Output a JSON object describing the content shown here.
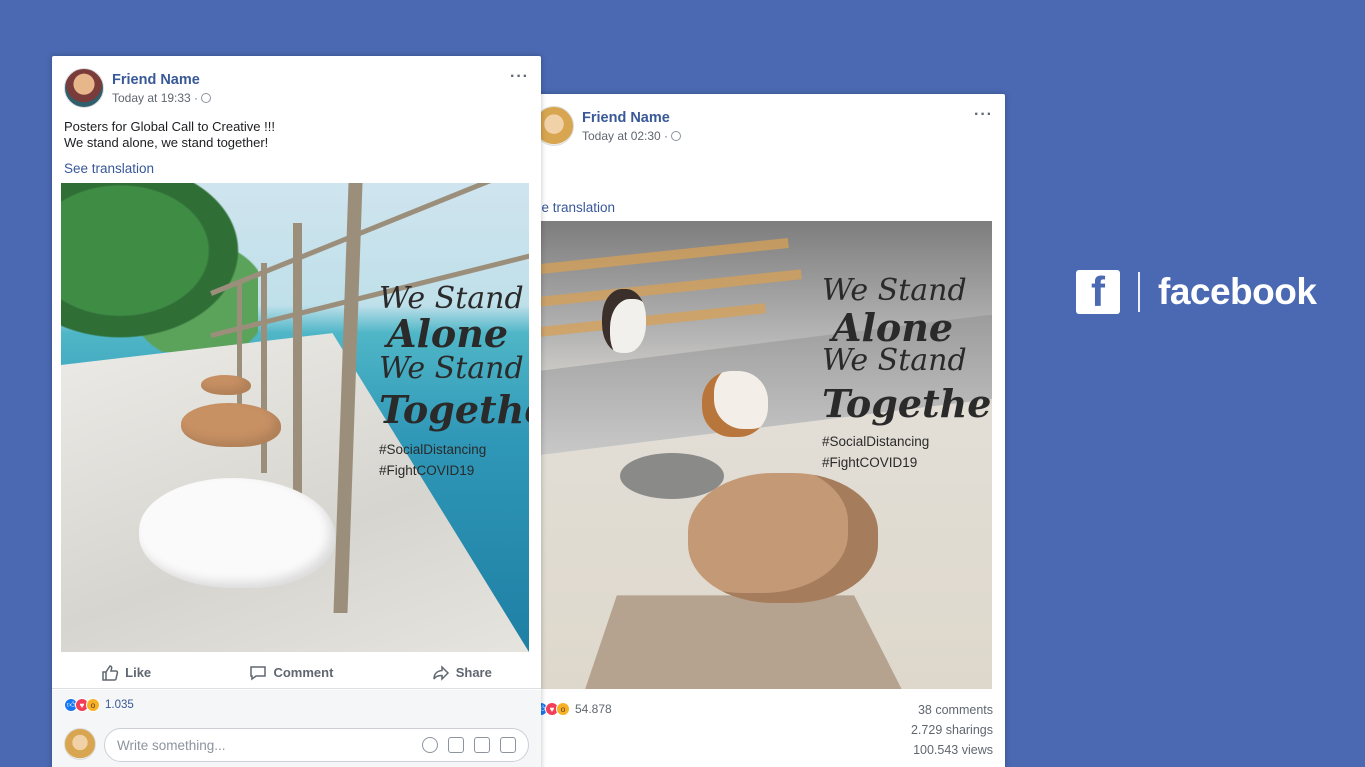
{
  "brand": {
    "logo_letter": "f",
    "wordmark": "facebook",
    "background_color": "#4a69b2"
  },
  "posts": [
    {
      "id": "front",
      "author": "Friend Name",
      "time": "Today at 19:33 ·",
      "text_lines": [
        "Posters for Global Call to Creative !!!",
        "We stand alone, we stand together!"
      ],
      "see_translation": "See translation",
      "poster": {
        "line1": "We Stand",
        "line2": "Alone",
        "line3": "We Stand",
        "line4": "Together",
        "hashtag1": "#SocialDistancing",
        "hashtag2": "#FightCOVID19"
      },
      "actions": {
        "like": "Like",
        "comment": "Comment",
        "share": "Share"
      },
      "reaction_count": "1.035",
      "comment_placeholder": "Write something..."
    },
    {
      "id": "back",
      "author": "Friend Name",
      "time": "Today at 02:30 ·",
      "see_translation": "ee translation",
      "poster": {
        "line1": "We Stand",
        "line2": "Alone",
        "line3": "We Stand",
        "line4": "Together",
        "hashtag1": "#SocialDistancing",
        "hashtag2": "#FightCOVID19"
      },
      "reaction_count": "54.878",
      "comments": "38 comments",
      "sharings": "2.729 sharings",
      "views": "100.543 views"
    }
  ],
  "icons": [
    "more-icon",
    "globe-icon",
    "like-icon",
    "comment-icon",
    "share-icon",
    "emoji-icon",
    "camera-icon",
    "gif-icon",
    "sticker-icon"
  ],
  "reaction_colors": {
    "like": "#1877f2",
    "love": "#f33e58",
    "wow": "#f7b125"
  },
  "link_color": "#385898"
}
